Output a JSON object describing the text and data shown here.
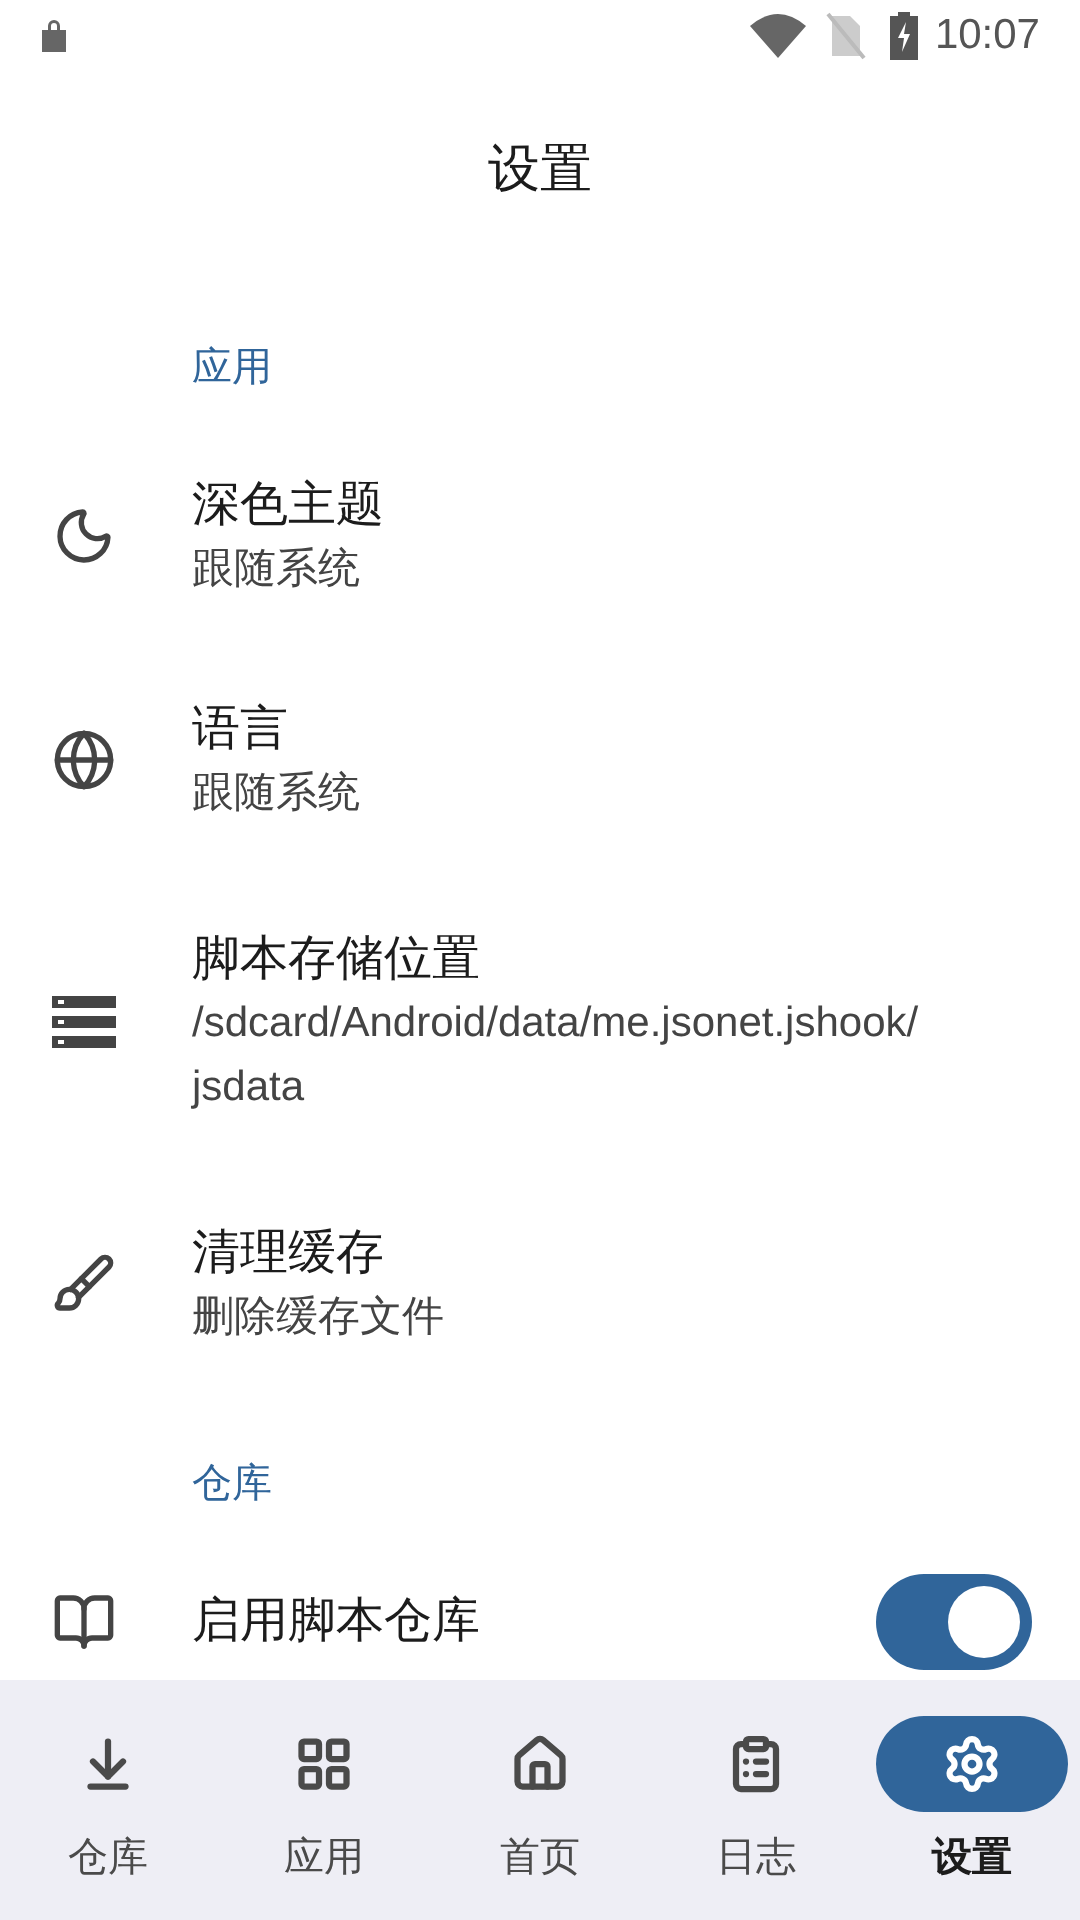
{
  "status_bar": {
    "time": "10:07"
  },
  "title": "设置",
  "sections": [
    {
      "header": "应用",
      "items": [
        {
          "kind": "nav",
          "title": "深色主题",
          "subtitle": "跟随系统"
        },
        {
          "kind": "nav",
          "title": "语言",
          "subtitle": "跟随系统"
        },
        {
          "kind": "nav",
          "title": "脚本存储位置",
          "subtitle": "/sdcard/Android/data/me.jsonet.jshook/jsdata"
        },
        {
          "kind": "nav",
          "title": "清理缓存",
          "subtitle": "删除缓存文件"
        }
      ]
    },
    {
      "header": "仓库",
      "items": [
        {
          "kind": "switch",
          "title": "启用脚本仓库",
          "on": true
        }
      ]
    }
  ],
  "bottom_nav": [
    {
      "label": "仓库",
      "selected": false
    },
    {
      "label": "应用",
      "selected": false
    },
    {
      "label": "首页",
      "selected": false
    },
    {
      "label": "日志",
      "selected": false
    },
    {
      "label": "设置",
      "selected": true
    }
  ]
}
